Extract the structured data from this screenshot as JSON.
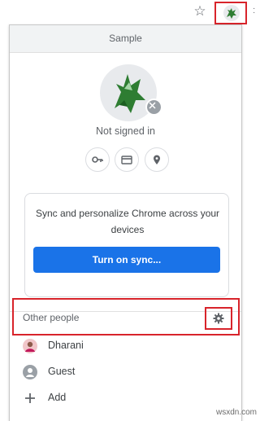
{
  "toolbar": {
    "bookmark_icon": "star-outline-icon",
    "profile_icon": "dragon-avatar-icon"
  },
  "profile_menu": {
    "header_title": "Sample",
    "status": "Not signed in",
    "shortcut_icons": [
      "key-icon",
      "credit-card-icon",
      "location-pin-icon"
    ],
    "sync_card": {
      "description": "Sync and personalize Chrome across your devices",
      "button_label": "Turn on sync..."
    },
    "other_people": {
      "label": "Other people",
      "settings_icon": "gear-icon",
      "people": [
        {
          "name": "Dharani",
          "icon": "avatar-photo-icon"
        },
        {
          "name": "Guest",
          "icon": "guest-person-icon"
        },
        {
          "name": "Add",
          "icon": "plus-icon"
        }
      ]
    }
  },
  "colors": {
    "accent": "#1a73e8",
    "highlight": "#d8242b"
  },
  "watermark": "wsxdn.com"
}
